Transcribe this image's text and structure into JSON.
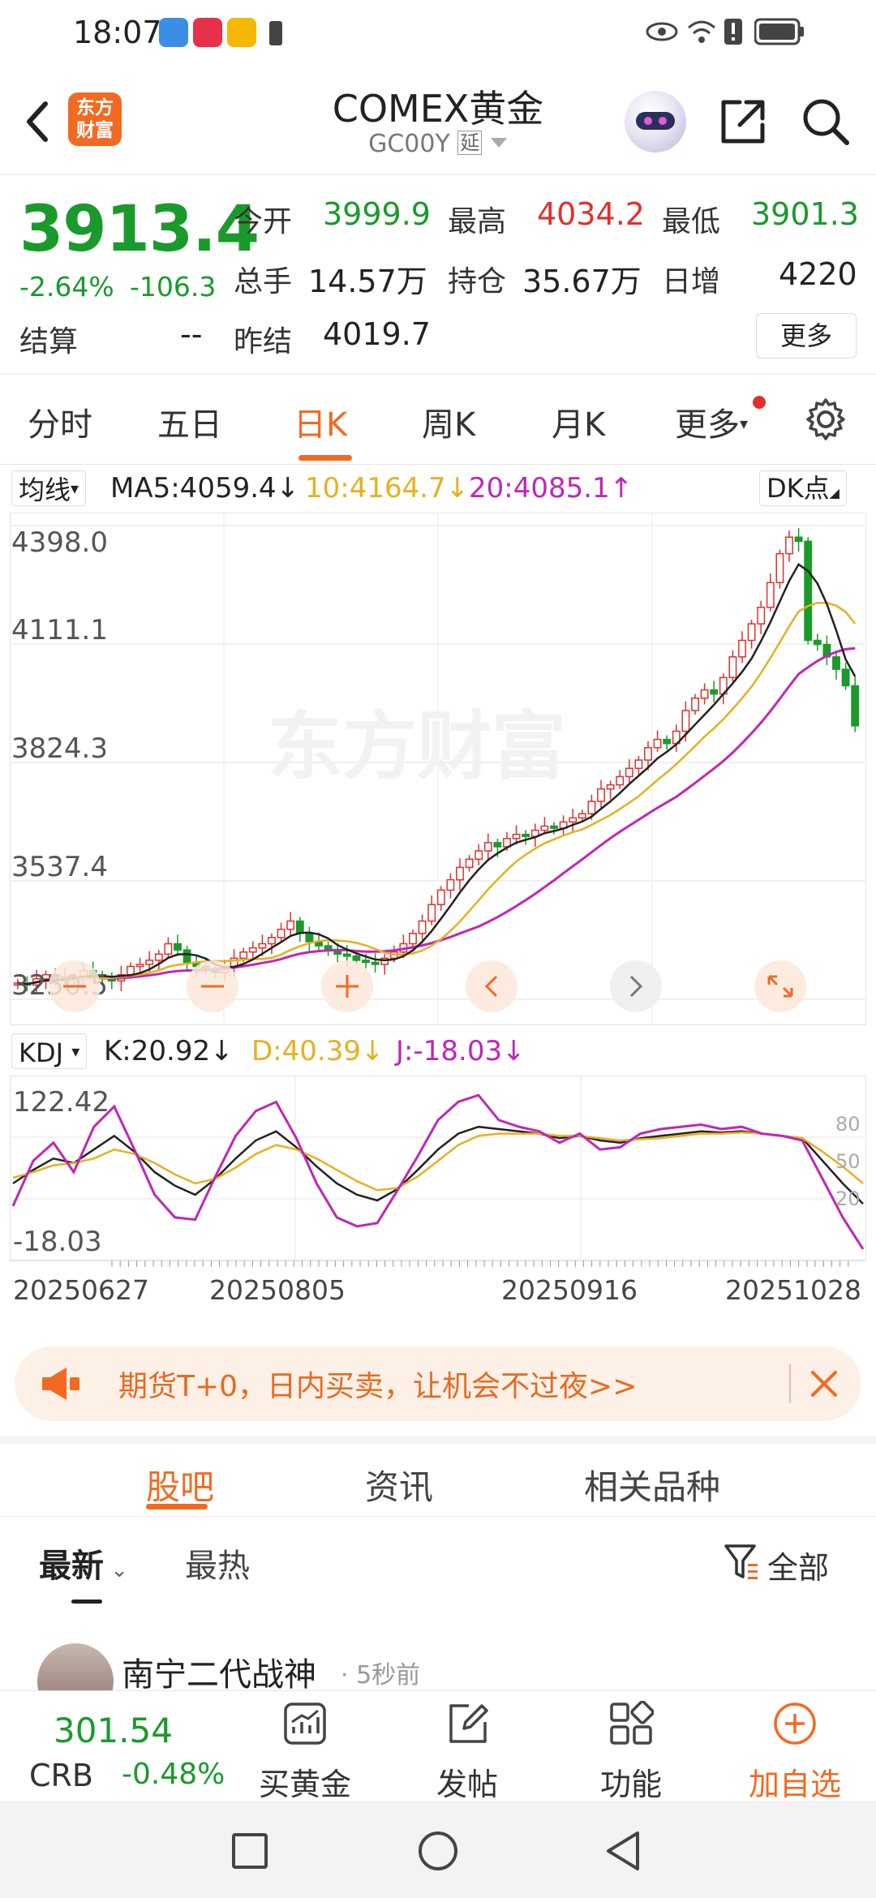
{
  "status_bar": {
    "time": "18:07"
  },
  "header": {
    "back_icon": "back-arrow-icon",
    "logo_text_line1": "东方",
    "logo_text_line2": "财富",
    "title": "COMEX黄金",
    "subtitle": "GC00Y",
    "subtitle_tag": "延",
    "share_icon": "share-icon",
    "search_icon": "search-icon"
  },
  "quote": {
    "price": "3913.4",
    "change_pct": "-2.64%",
    "change_abs": "-106.3",
    "settle_label": "结算",
    "settle_value": "--",
    "open_label": "今开",
    "open_value": "3999.9",
    "high_label": "最高",
    "high_value": "4034.2",
    "low_label": "最低",
    "low_value": "3901.3",
    "volume_label": "总手",
    "volume_value": "14.57万",
    "oi_label": "持仓",
    "oi_value": "35.67万",
    "daily_inc_label": "日增",
    "daily_inc_value": "4220",
    "prev_settle_label": "昨结",
    "prev_settle_value": "4019.7",
    "more_label": "更多"
  },
  "period_tabs": [
    "分时",
    "五日",
    "日K",
    "周K",
    "月K",
    "更多"
  ],
  "active_period": "日K",
  "ma_line": {
    "selector": "均线",
    "ma5": "MA5:4059.4↓",
    "ma10": "10:4164.7↓",
    "ma20": "20:4085.1↑",
    "dk_label": "DK点"
  },
  "kdj_line": {
    "selector": "KDJ",
    "k": "K:20.92↓",
    "d": "D:40.39↓",
    "j": "J:-18.03↓"
  },
  "colors": {
    "up": "#e0302e",
    "down": "#1a9a2b",
    "accent": "#f26a21",
    "ma5": "#222222",
    "ma10": "#e8b020",
    "ma20": "#c026b8"
  },
  "chart_data": [
    {
      "type": "candlestick",
      "title": "",
      "y_ticks": [
        "4398.0",
        "4111.1",
        "3824.3",
        "3537.4",
        "3250.5"
      ],
      "ylim": [
        3250.5,
        4398.0
      ],
      "watermark": "东方财富",
      "x_labels": [
        "20250627",
        "20250805",
        "20250916",
        "20251028"
      ],
      "close_series_approx": [
        3290,
        3285,
        3300,
        3310,
        3295,
        3305,
        3300,
        3320,
        3310,
        3300,
        3295,
        3310,
        3330,
        3335,
        3345,
        3360,
        3385,
        3370,
        3340,
        3330,
        3320,
        3315,
        3330,
        3350,
        3365,
        3375,
        3385,
        3400,
        3420,
        3440,
        3410,
        3390,
        3380,
        3370,
        3360,
        3355,
        3345,
        3340,
        3335,
        3350,
        3365,
        3385,
        3410,
        3440,
        3480,
        3515,
        3540,
        3570,
        3590,
        3610,
        3630,
        3620,
        3640,
        3650,
        3645,
        3660,
        3670,
        3665,
        3680,
        3690,
        3700,
        3730,
        3760,
        3770,
        3790,
        3810,
        3830,
        3860,
        3880,
        3870,
        3900,
        3950,
        3980,
        4000,
        3990,
        4030,
        4080,
        4120,
        4160,
        4200,
        4260,
        4330,
        4370,
        4360,
        4120,
        4110,
        4080,
        4050,
        4010,
        3913
      ],
      "ma_legend": [
        "MA5:4059.4↓",
        "10:4164.7↓",
        "20:4085.1↑"
      ]
    },
    {
      "type": "line",
      "title": "",
      "y_ticks": [
        "122.42",
        "-18.03"
      ],
      "right_ticks": [
        "80",
        "50",
        "20"
      ],
      "ylim": [
        -18.03,
        122.42
      ],
      "series": [
        {
          "name": "K",
          "values": [
            40,
            52,
            62,
            58,
            70,
            82,
            68,
            50,
            38,
            30,
            44,
            62,
            78,
            86,
            72,
            55,
            40,
            30,
            25,
            35,
            52,
            70,
            84,
            90,
            88,
            86,
            84,
            80,
            82,
            78,
            76,
            80,
            82,
            84,
            86,
            85,
            86,
            84,
            82,
            80,
            60,
            40,
            22
          ]
        },
        {
          "name": "D",
          "values": [
            45,
            50,
            56,
            58,
            62,
            70,
            66,
            58,
            48,
            40,
            44,
            54,
            66,
            74,
            70,
            62,
            52,
            42,
            34,
            36,
            46,
            60,
            74,
            82,
            84,
            84,
            84,
            82,
            82,
            80,
            78,
            79,
            80,
            82,
            84,
            84,
            85,
            84,
            82,
            80,
            68,
            55,
            40
          ]
        },
        {
          "name": "J",
          "values": [
            20,
            60,
            76,
            50,
            90,
            108,
            70,
            30,
            10,
            8,
            46,
            82,
            104,
            112,
            80,
            40,
            10,
            2,
            5,
            34,
            64,
            96,
            112,
            118,
            96,
            90,
            86,
            76,
            84,
            70,
            72,
            84,
            88,
            90,
            92,
            88,
            90,
            84,
            82,
            78,
            44,
            10,
            -18
          ]
        }
      ]
    }
  ],
  "banner": {
    "text": "期货T+0，日内买卖，让机会不过夜>>"
  },
  "bottom_tabs": [
    "股吧",
    "资讯",
    "相关品种"
  ],
  "active_bottom_tab": "股吧",
  "filters": {
    "latest": "最新",
    "hot": "最热",
    "all": "全部"
  },
  "post_preview": {
    "author": "南宁二代战神",
    "time": "5秒前"
  },
  "bottom_nav": {
    "crb_value": "301.54",
    "crb_label": "CRB",
    "crb_change": "-0.48%",
    "buy_gold": "买黄金",
    "post": "发帖",
    "function": "功能",
    "add_watch": "加自选"
  }
}
